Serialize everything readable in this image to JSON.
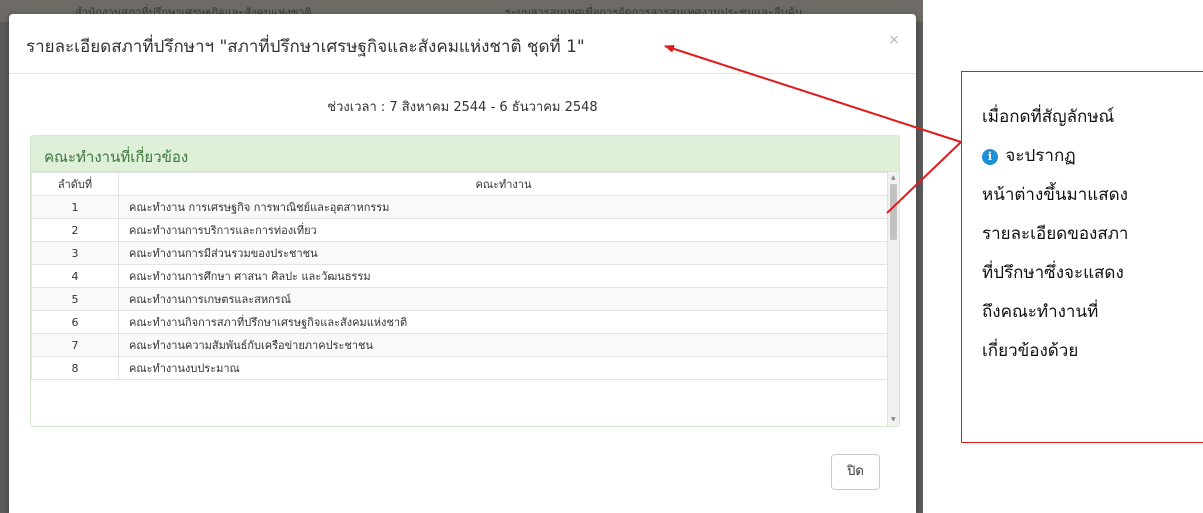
{
  "background": {
    "strip_left_text": "สำนักงานสภาที่ปรึกษาเศรษฐกิจและสังคมแห่งชาติ",
    "strip_right_text": "ระบบสารสนเทศเพื่อการจัดการสารสนเทศงานประชุมและสืบค้น"
  },
  "modal": {
    "title": "รายละเอียดสภาที่ปรึกษาฯ \"สภาที่ปรึกษาเศรษฐกิจและสังคมแห่งชาติ ชุดที่ 1\"",
    "close_icon": "×",
    "period": "ช่วงเวลา : 7 สิงหาคม 2544 - 6 ธันวาคม 2548",
    "panel_heading": "คณะทำงานที่เกี่ยวข้อง",
    "table": {
      "headers": [
        "ลำดับที่",
        "คณะทำงาน"
      ],
      "rows": [
        {
          "no": "1",
          "name": "คณะทำงาน การเศรษฐกิจ การพาณิชย์และอุตสาหกรรม"
        },
        {
          "no": "2",
          "name": "คณะทำงานการบริการและการท่องเที่ยว"
        },
        {
          "no": "3",
          "name": "คณะทำงานการมีส่วนรวมของประชาชน"
        },
        {
          "no": "4",
          "name": "คณะทำงานการศึกษา ศาสนา ศิลปะ และวัฒนธรรม"
        },
        {
          "no": "5",
          "name": "คณะทำงานการเกษตรและสหกรณ์"
        },
        {
          "no": "6",
          "name": "คณะทำงานกิจการสภาที่ปรึกษาเศรษฐกิจและสังคมแห่งชาติ"
        },
        {
          "no": "7",
          "name": "คณะทำงานความสัมพันธ์กับเครือข่ายภาคประชาชน"
        },
        {
          "no": "8",
          "name": "คณะทำงานงบประมาณ"
        }
      ]
    },
    "close_button": "ปิด"
  },
  "callout": {
    "lines": [
      "เมื่อกดที่สัญลักษณ์",
      "จะปรากฏ",
      "หน้าต่างขึ้นมาแสดง",
      "รายละเอียดของสภา",
      "ที่ปรึกษาซึ่งจะแสดง",
      "ถึงคณะทำงานที่",
      "เกี่ยวข้องด้วย"
    ],
    "info_icon": "info-circle-icon",
    "info_glyph": "i"
  },
  "colors": {
    "panel_heading_bg": "#dff0d8",
    "panel_heading_text": "#3c763d",
    "annotation_red": "#e01b1b",
    "info_blue": "#1e90d6"
  }
}
